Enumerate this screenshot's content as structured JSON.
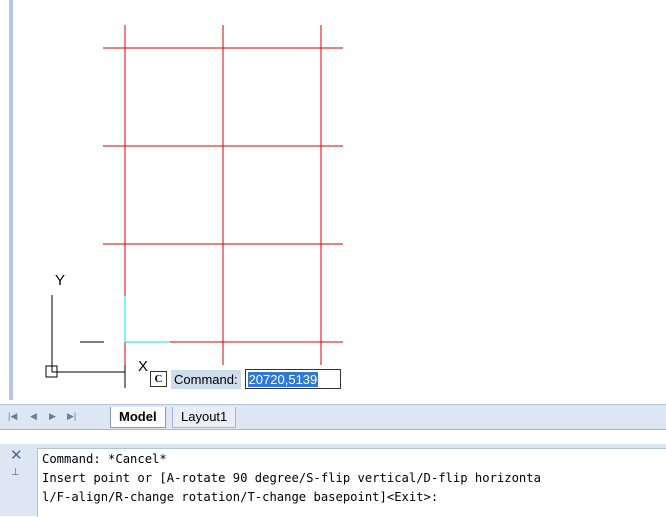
{
  "ucs": {
    "y_label": "Y",
    "x_label": "X"
  },
  "grid_color": "#e00000",
  "crosshair_color": "#00e5ff",
  "dynamic_input": {
    "badge": "C",
    "label": "Command:",
    "value": "20720,5139"
  },
  "tabs": {
    "nav": [
      "first-icon",
      "prev-icon",
      "next-icon",
      "last-icon"
    ],
    "model": "Model",
    "layout1": "Layout1"
  },
  "command_window": {
    "lines": [
      "Command: *Cancel*",
      "Insert point or [A-rotate 90 degree/S-flip vertical/D-flip horizonta",
      "l/F-align/R-change rotation/T-change basepoint]<Exit>:"
    ]
  }
}
